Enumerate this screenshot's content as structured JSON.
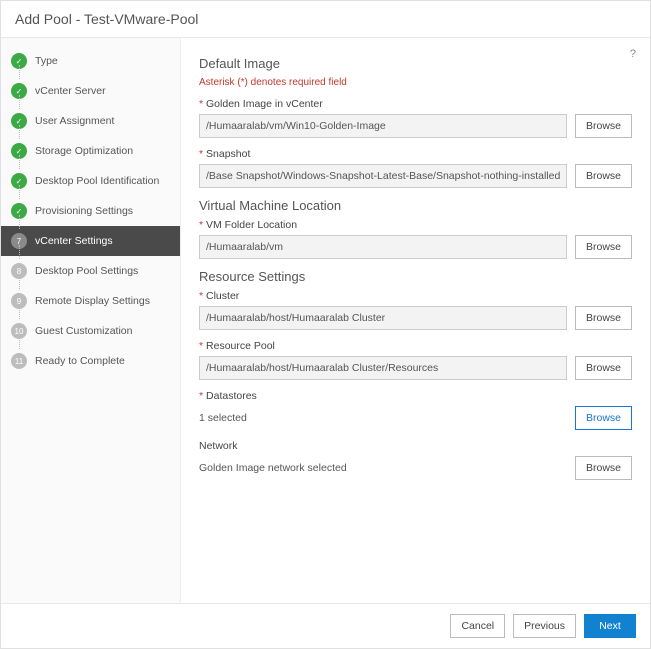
{
  "header": {
    "title": "Add Pool - Test-VMware-Pool"
  },
  "helpIcon": "?",
  "steps": [
    {
      "num": "✓",
      "label": "Type",
      "state": "done"
    },
    {
      "num": "✓",
      "label": "vCenter Server",
      "state": "done"
    },
    {
      "num": "✓",
      "label": "User Assignment",
      "state": "done"
    },
    {
      "num": "✓",
      "label": "Storage Optimization",
      "state": "done"
    },
    {
      "num": "✓",
      "label": "Desktop Pool Identification",
      "state": "done"
    },
    {
      "num": "✓",
      "label": "Provisioning Settings",
      "state": "done"
    },
    {
      "num": "7",
      "label": "vCenter Settings",
      "state": "active"
    },
    {
      "num": "8",
      "label": "Desktop Pool Settings",
      "state": "pending"
    },
    {
      "num": "9",
      "label": "Remote Display Settings",
      "state": "pending"
    },
    {
      "num": "10",
      "label": "Guest Customization",
      "state": "pending"
    },
    {
      "num": "11",
      "label": "Ready to Complete",
      "state": "pending"
    }
  ],
  "sections": {
    "defaultImage": {
      "title": "Default Image",
      "note": "Asterisk (*) denotes required field",
      "goldenLabel": "Golden Image in vCenter",
      "goldenValue": "/Humaaralab/vm/Win10-Golden-Image",
      "snapshotLabel": "Snapshot",
      "snapshotValue": "/Base Snapshot/Windows-Snapshot-Latest-Base/Snapshot-nothing-installed-all-"
    },
    "vmLocation": {
      "title": "Virtual Machine Location",
      "folderLabel": "VM Folder Location",
      "folderValue": "/Humaaralab/vm"
    },
    "resource": {
      "title": "Resource Settings",
      "clusterLabel": "Cluster",
      "clusterValue": "/Humaaralab/host/Humaaralab Cluster",
      "poolLabel": "Resource Pool",
      "poolValue": "/Humaaralab/host/Humaaralab Cluster/Resources",
      "datastoresLabel": "Datastores",
      "datastoresValue": "1 selected",
      "networkLabel": "Network",
      "networkValue": "Golden Image network selected"
    }
  },
  "buttons": {
    "browse": "Browse",
    "cancel": "Cancel",
    "previous": "Previous",
    "next": "Next"
  }
}
